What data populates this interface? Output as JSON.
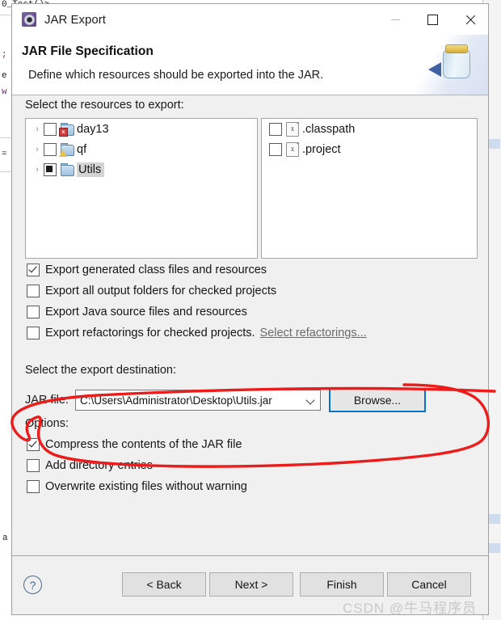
{
  "window": {
    "title": "JAR Export",
    "icon": "jar-export-icon",
    "controls": {
      "minimize": "minimize-icon",
      "maximize": "maximize-icon",
      "close": "close-icon"
    }
  },
  "header": {
    "title": "JAR File Specification",
    "subtitle": "Define which resources should be exported into the JAR.",
    "art_icon": "jar-illustration"
  },
  "resources": {
    "label": "Select the resources to export:",
    "tree_items": [
      {
        "label": "day13",
        "checked": "unchecked",
        "expander": "›",
        "icon": "java-project-icon",
        "overlay": "error",
        "selected": false
      },
      {
        "label": "qf",
        "checked": "unchecked",
        "expander": "›",
        "icon": "java-project-icon",
        "overlay": "warning",
        "selected": false
      },
      {
        "label": "Utils",
        "checked": "partial",
        "expander": "›",
        "icon": "java-project-icon",
        "overlay": "none",
        "selected": true
      }
    ],
    "file_items": [
      {
        "label": ".classpath",
        "checked": "unchecked",
        "icon": "xml-file-icon"
      },
      {
        "label": ".project",
        "checked": "unchecked",
        "icon": "xml-file-icon"
      }
    ]
  },
  "export_options": [
    {
      "label": "Export generated class files and resources",
      "checked": true
    },
    {
      "label": "Export all output folders for checked projects",
      "checked": false
    },
    {
      "label": "Export Java source files and resources",
      "checked": false
    },
    {
      "label": "Export refactorings for checked projects.",
      "checked": false,
      "link": "Select refactorings..."
    }
  ],
  "destination": {
    "label": "Select the export destination:",
    "jar_file_label": "JAR file:",
    "jar_file_value": "C:\\Users\\Administrator\\Desktop\\Utils.jar",
    "jar_file_placeholder": "",
    "browse_label": "Browse..."
  },
  "options": {
    "label": "Options:",
    "items": [
      {
        "label": "Compress the contents of the JAR file",
        "checked": true
      },
      {
        "label": "Add directory entries",
        "checked": false
      },
      {
        "label": "Overwrite existing files without warning",
        "checked": false
      }
    ]
  },
  "buttons": {
    "help": "?",
    "back": "< Back",
    "next": "Next >",
    "finish": "Finish",
    "cancel": "Cancel"
  },
  "annotation": {
    "color": "#ee1b1b",
    "shape": "hand-drawn-ellipse"
  },
  "watermark": "CSDN @牛马程序员",
  "background_code": [
    "0_Test()>",
    ";",
    "e",
    "w",
    "=",
    "a"
  ]
}
